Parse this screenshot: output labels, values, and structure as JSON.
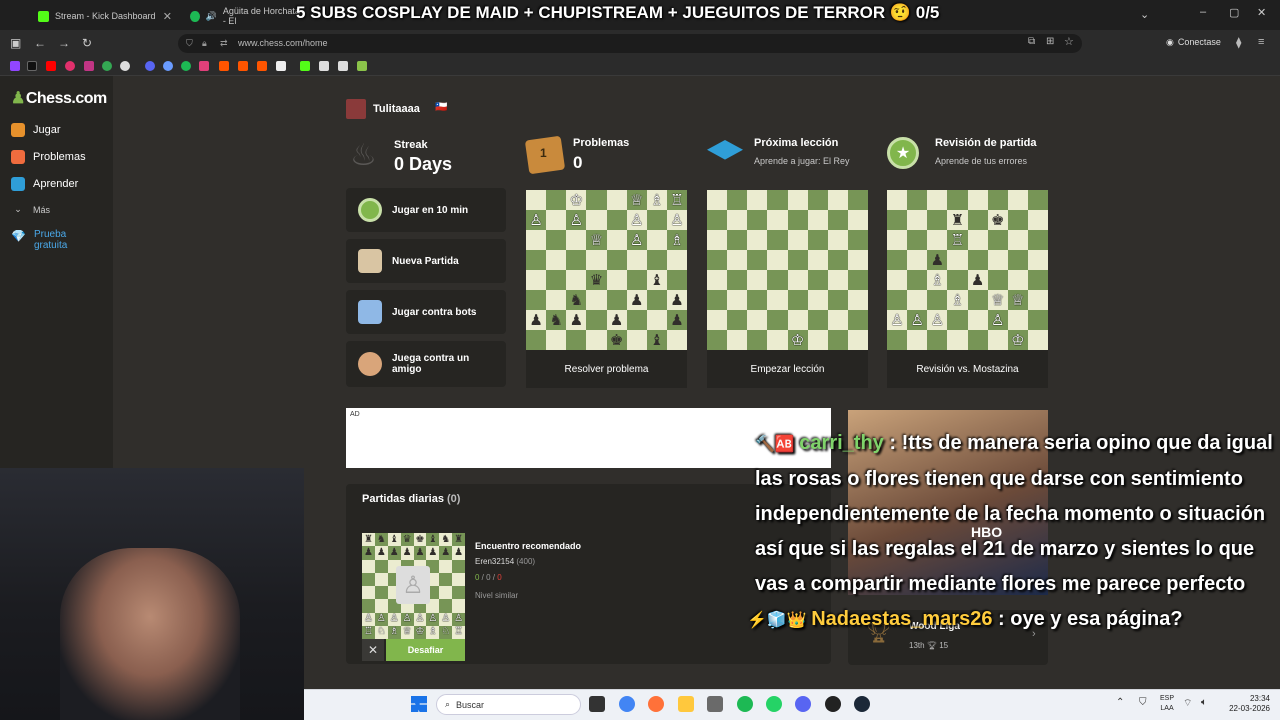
{
  "browser": {
    "tabs": [
      {
        "label": "Stream - Kick Dashboard",
        "color": "#53fc18"
      },
      {
        "label": "Agüita de Horchata - El",
        "color": "#1db954"
      }
    ],
    "url": "www.chess.com/home",
    "connect_label": "Conectase"
  },
  "stream_overlay": {
    "title": "5 SUBS COSPLAY DE MAID + CHUPISTREAM + JUEGUITOS DE TERROR 🤨 0/5"
  },
  "sidebar": {
    "logo": "Chess.com",
    "items": [
      {
        "label": "Jugar"
      },
      {
        "label": "Problemas"
      },
      {
        "label": "Aprender"
      },
      {
        "label": "Más"
      },
      {
        "label": "Prueba gratuita"
      }
    ]
  },
  "profile": {
    "username": "Tulitaaaa",
    "flag": "🇨🇱"
  },
  "stats": {
    "streak_label": "Streak",
    "streak_value": "0 Days",
    "puzzles_label": "Problemas",
    "puzzles_value": "0",
    "puzzles_badge": "1",
    "lesson_label": "Próxima lección",
    "lesson_sub": "Aprende a jugar: El Rey",
    "review_label": "Revisión de partida",
    "review_sub": "Aprende de tus errores"
  },
  "quick_actions": [
    {
      "label": "Jugar en 10 min",
      "icon": "stopwatch-icon"
    },
    {
      "label": "Nueva Partida",
      "icon": "pawn-hand-icon"
    },
    {
      "label": "Jugar contra bots",
      "icon": "robot-icon"
    },
    {
      "label": "Juega contra un amigo",
      "icon": "handshake-icon"
    }
  ],
  "boards": [
    {
      "caption": "Resolver problema"
    },
    {
      "caption": "Empezar lección"
    },
    {
      "caption": "Revisión vs. Mostazina"
    }
  ],
  "ad_label": "AD",
  "daily": {
    "title": "Partidas diarias",
    "count": "(0)",
    "match_title": "Encuentro recomendado",
    "opponent": "Eren32154",
    "rating": "(400)",
    "record_w": "0",
    "record_d": "0",
    "record_l": "0",
    "level": "Nivel similar",
    "challenge": "Desafiar"
  },
  "league": {
    "name": "Wood Liga",
    "rank": "13th",
    "trophies": "15"
  },
  "chat": [
    {
      "user": "carri_thy",
      "message": ": !tts de manera seria opino que da igual las rosas o flores tienen que darse con sentimiento independientemente de la fecha momento o situación así que si las regalas el 21 de marzo y sientes lo que vas a compartir mediante flores me parece perfecto"
    },
    {
      "user": "Nadaestas_mars26",
      "message": ": oye y esa página?"
    }
  ],
  "taskbar": {
    "search": "Buscar",
    "lang1": "ESP",
    "lang2": "LAA",
    "time": "23:34",
    "date": "22-03-2026"
  },
  "colors": {
    "accent": "#81b64c",
    "board_light": "#ebecd0",
    "board_dark": "#779556",
    "bg": "#302e2b"
  }
}
